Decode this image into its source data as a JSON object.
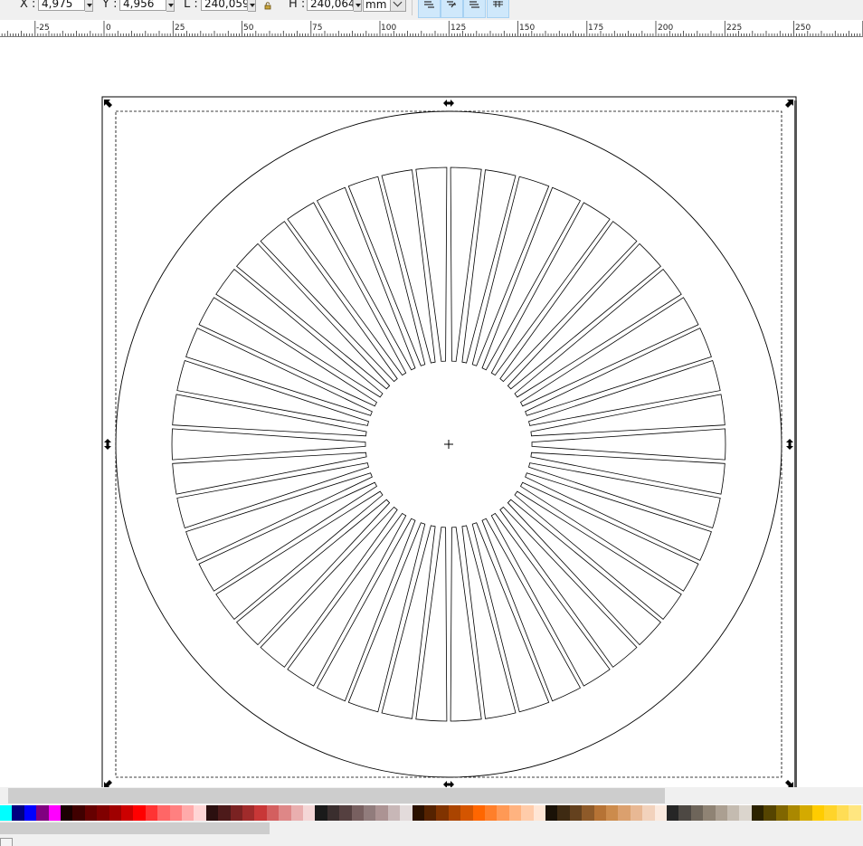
{
  "toolbar": {
    "x_label": "X :",
    "x_value": "4,975",
    "y_label": "Y :",
    "y_value": "4,956",
    "w_label": "L :",
    "w_value": "240,059",
    "h_label": "H :",
    "h_value": "240,064",
    "unit": "mm",
    "lock_icon": "lock-icon",
    "snap_buttons": [
      "snap-scale-stroke-icon",
      "snap-scale-corners-icon",
      "snap-move-gradients-icon",
      "snap-move-patterns-icon"
    ]
  },
  "ruler": {
    "labels": [
      "-25",
      "0",
      "25",
      "50",
      "75",
      "100",
      "125",
      "150",
      "175",
      "200",
      "225",
      "250"
    ]
  },
  "canvas": {
    "page_frame_color": "#000000",
    "shape_stroke_color": "#000000",
    "selection_cue_color": "#000000",
    "shape": "circular vent grille with 50 radial slots",
    "slot_count": 50
  },
  "palette": {
    "colors": [
      "#00ffff",
      "#000080",
      "#0000ff",
      "#800080",
      "#ff00ff",
      "#1a0000",
      "#400000",
      "#660000",
      "#800000",
      "#a00000",
      "#cc0000",
      "#ff0000",
      "#ff3333",
      "#ff6666",
      "#ff8080",
      "#ffaaaa",
      "#ffd5d5",
      "#2b0f0f",
      "#4d1a1a",
      "#7a2222",
      "#a02b2b",
      "#c83737",
      "#d35f5f",
      "#de8787",
      "#e9afaf",
      "#f4d7d7",
      "#1a1a1a",
      "#3a2e2e",
      "#554040",
      "#786060",
      "#917c7c",
      "#ac9393",
      "#c8b7b7",
      "#e3dbdb",
      "#2b1100",
      "#552200",
      "#803300",
      "#aa4400",
      "#d45500",
      "#ff6600",
      "#ff7f2a",
      "#ff9955",
      "#ffb380",
      "#ffccaa",
      "#ffe6d5",
      "#1a1207",
      "#3e2a12",
      "#64411e",
      "#8e5a29",
      "#b67335",
      "#cc8b4c",
      "#dba06e",
      "#e8b894",
      "#f2d2bc",
      "#fbeadf",
      "#262626",
      "#4d4843",
      "#6e655a",
      "#8f8374",
      "#ab9f91",
      "#c4bbb0",
      "#dbd5cd",
      "#2b2200",
      "#554400",
      "#806600",
      "#aa8800",
      "#d4aa00",
      "#ffcc00",
      "#ffd42a",
      "#ffdd55",
      "#ffe680"
    ]
  },
  "scrollbars": {
    "horizontal_thumb": "scrollbar-thumb",
    "palette_thumb": "palette-scrollbar-thumb"
  }
}
